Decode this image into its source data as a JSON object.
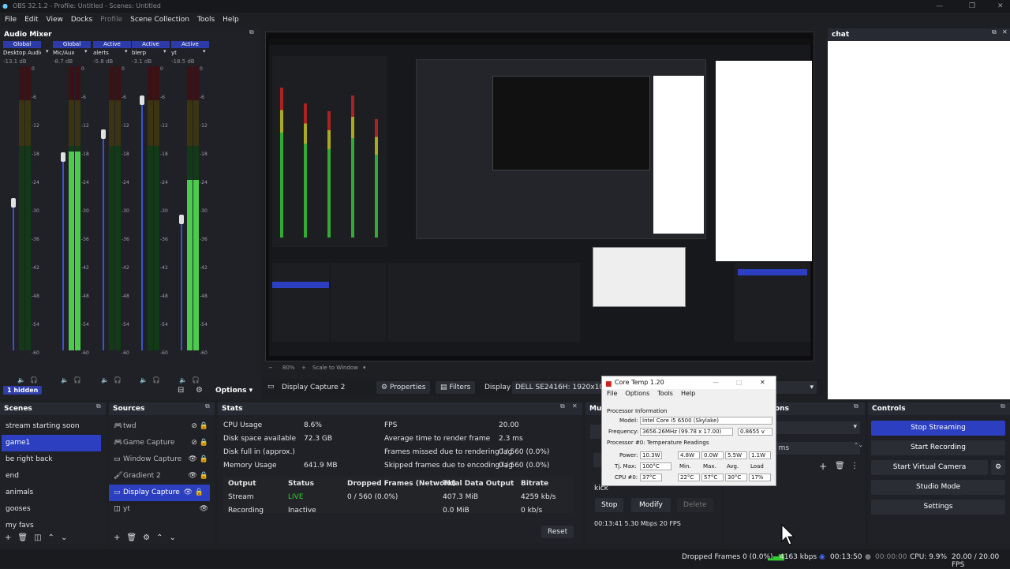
{
  "window": {
    "title": "OBS 32.1.2 - Profile: Untitled - Scenes: Untitled"
  },
  "menu": [
    "File",
    "Edit",
    "View",
    "Docks",
    "Profile",
    "Scene Collection",
    "Tools",
    "Help"
  ],
  "audio_mixer": {
    "title": "Audio Mixer",
    "channels": [
      {
        "badge": "Global",
        "name": "Desktop Audio",
        "db": "-13.1 dB",
        "level": 0.0,
        "fader": 0.52
      },
      {
        "badge": "Global",
        "name": "Mic/Aux",
        "db": "-8.7 dB",
        "level": 0.7,
        "fader": 0.68
      },
      {
        "badge": "Active",
        "name": "alerts",
        "db": "-5.8 dB",
        "level": 0.0,
        "fader": 0.76
      },
      {
        "badge": "Active",
        "name": "blerp",
        "db": "-3.1 dB",
        "level": 0.0,
        "fader": 0.88
      },
      {
        "badge": "Active",
        "name": "yt",
        "db": "-18.5 dB",
        "level": 0.6,
        "fader": 0.46
      }
    ],
    "scale": [
      "0",
      "-6",
      "-12",
      "-18",
      "-24",
      "-30",
      "-36",
      "-42",
      "-48",
      "-54",
      "-60"
    ],
    "hidden_label": "1 hidden",
    "options_label": "Options"
  },
  "preview": {
    "zoom": "80%",
    "scale_mode": "Scale to Window"
  },
  "source_toolbar": {
    "source": "Display Capture 2",
    "properties": "Properties",
    "filters": "Filters",
    "display_label": "Display",
    "display_value": "DELL SE2416H: 1920x1080"
  },
  "chat": {
    "title": "chat"
  },
  "scenes": {
    "title": "Scenes",
    "items": [
      "stream starting soon",
      "game1",
      "be right back",
      "end",
      "animals",
      "gooses",
      "my favs"
    ],
    "selected": 1
  },
  "sources": {
    "title": "Sources",
    "items": [
      {
        "icon": "gamepad",
        "label": "twd"
      },
      {
        "icon": "gamepad",
        "label": "Game Capture"
      },
      {
        "icon": "window",
        "label": "Window Capture"
      },
      {
        "icon": "brush",
        "label": "Gradient 2"
      },
      {
        "icon": "monitor",
        "label": "Display Capture"
      },
      {
        "icon": "browser",
        "label": "yt"
      }
    ],
    "selected": 4
  },
  "stats": {
    "title": "Stats",
    "left": [
      [
        "CPU Usage",
        "8.6%"
      ],
      [
        "Disk space available",
        "72.3 GB"
      ],
      [
        "Disk full in (approx.)",
        ""
      ],
      [
        "Memory Usage",
        "641.9 MB"
      ]
    ],
    "right": [
      [
        "FPS",
        "20.00"
      ],
      [
        "Average time to render frame",
        "2.3 ms"
      ],
      [
        "Frames missed due to rendering lag",
        "0 / 560 (0.0%)"
      ],
      [
        "Skipped frames due to encoding lag",
        "0 / 560 (0.0%)"
      ]
    ],
    "table_headers": [
      "Output",
      "Status",
      "Dropped Frames (Network)",
      "Total Data Output",
      "Bitrate"
    ],
    "rows": [
      [
        "Stream",
        "LIVE",
        "0 / 560 (0.0%)",
        "407.3 MiB",
        "4259 kb/s"
      ],
      [
        "Recording",
        "Inactive",
        "",
        "0.0 MiB",
        "0 kb/s"
      ]
    ],
    "reset": "Reset"
  },
  "multistream": {
    "title_fragment": "Mul",
    "target": "kick",
    "stop": "Stop",
    "modify": "Modify",
    "delete": "Delete",
    "status": "00:13:41  5.30 Mbps  20 FPS"
  },
  "transitions": {
    "title_fragment": "ons",
    "duration_fragment": "0 ms"
  },
  "controls": {
    "title": "Controls",
    "buttons": [
      "Stop Streaming",
      "Start Recording",
      "Start Virtual Camera",
      "Studio Mode",
      "Settings"
    ]
  },
  "core_temp": {
    "title": "Core Temp 1.20",
    "menu": [
      "File",
      "Options",
      "Tools",
      "Help"
    ],
    "group": "Processor Information",
    "model_label": "Model:",
    "model": "Intel Core i5 6500 (Skylake)",
    "freq_label": "Frequency:",
    "freq": "3656.26MHz (99.78 x 17.00)",
    "voltage": "0.8655 v",
    "readings_title": "Processor #0: Temperature Readings",
    "power_label": "Power:",
    "power": [
      "10.3W",
      "4.8W",
      "0.0W",
      "5.5W",
      "1.1W"
    ],
    "tjmax_label": "Tj. Max:",
    "tjmax": "100°C",
    "heads": [
      "Min.",
      "Max.",
      "Avg.",
      "Load"
    ],
    "cpu_label": "CPU #0:",
    "cpu": [
      "37°C",
      "22°C",
      "57°C",
      "30°C",
      "17%"
    ]
  },
  "statusbar": {
    "dropped": "Dropped Frames 0 (0.0%)",
    "bitrate": "4163 kbps",
    "live_time": "00:13:50",
    "rec_time": "00:00:00",
    "cpu": "CPU: 9.9%",
    "fps": "20.00 / 20.00 FPS"
  },
  "colors": {
    "accent": "#2c3fc0",
    "live": "#33cc33",
    "meter_green": "#4ccc4c",
    "meter_yellow": "#c8b020",
    "meter_red": "#c02020"
  }
}
